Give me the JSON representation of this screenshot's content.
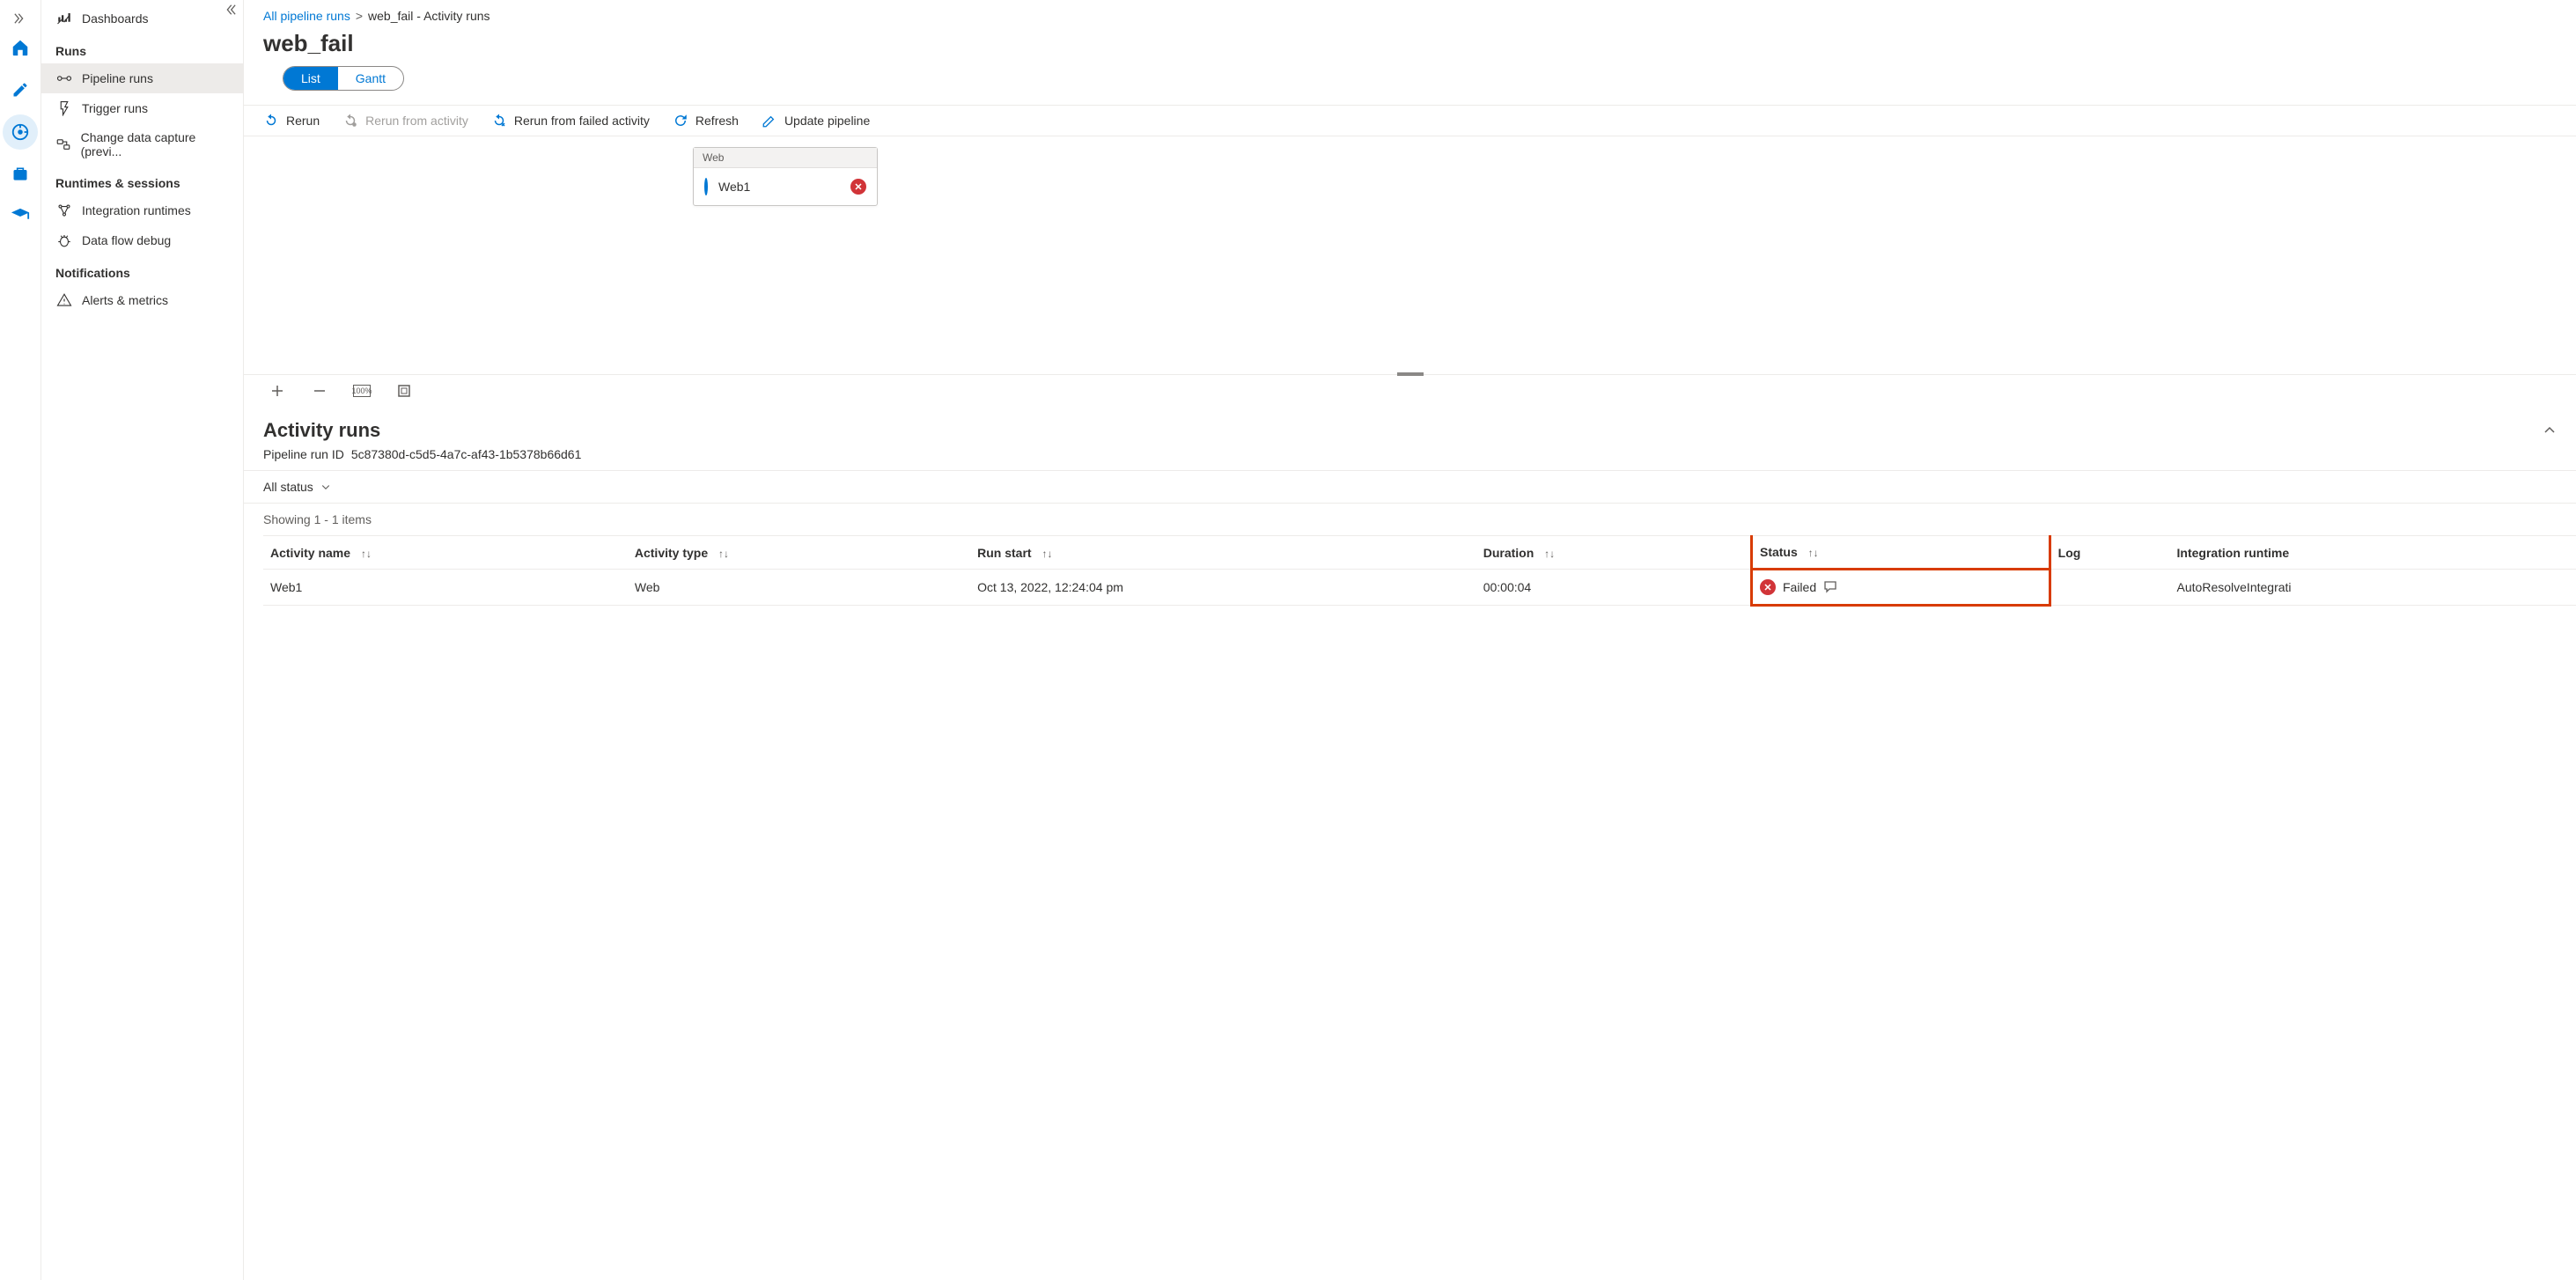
{
  "rail": {
    "items": [
      "home",
      "author",
      "monitor",
      "manage",
      "learn"
    ]
  },
  "sidebar": {
    "dashboards": "Dashboards",
    "sections": {
      "runs": "Runs",
      "runtimes": "Runtimes & sessions",
      "notifications": "Notifications"
    },
    "items": {
      "pipeline_runs": "Pipeline runs",
      "trigger_runs": "Trigger runs",
      "cdc": "Change data capture (previ...",
      "integration_runtimes": "Integration runtimes",
      "dataflow_debug": "Data flow debug",
      "alerts": "Alerts & metrics"
    }
  },
  "breadcrumb": {
    "root": "All pipeline runs",
    "current": "web_fail - Activity runs"
  },
  "page_title": "web_fail",
  "view_toggle": {
    "list": "List",
    "gantt": "Gantt"
  },
  "toolbar": {
    "rerun": "Rerun",
    "rerun_from_activity": "Rerun from activity",
    "rerun_from_failed": "Rerun from failed activity",
    "refresh": "Refresh",
    "update_pipeline": "Update pipeline"
  },
  "canvas": {
    "node_type": "Web",
    "node_name": "Web1"
  },
  "zoom": {
    "reset_label": "100%"
  },
  "activity_runs": {
    "heading": "Activity runs",
    "run_id_label": "Pipeline run ID",
    "run_id": "5c87380d-c5d5-4a7c-af43-1b5378b66d61",
    "filter_status": "All status",
    "showing": "Showing 1 - 1 items",
    "columns": {
      "activity_name": "Activity name",
      "activity_type": "Activity type",
      "run_start": "Run start",
      "duration": "Duration",
      "status": "Status",
      "log": "Log",
      "integration_runtime": "Integration runtime"
    },
    "rows": [
      {
        "activity_name": "Web1",
        "activity_type": "Web",
        "run_start": "Oct 13, 2022, 12:24:04 pm",
        "duration": "00:00:04",
        "status": "Failed",
        "integration_runtime": "AutoResolveIntegrati"
      }
    ]
  }
}
